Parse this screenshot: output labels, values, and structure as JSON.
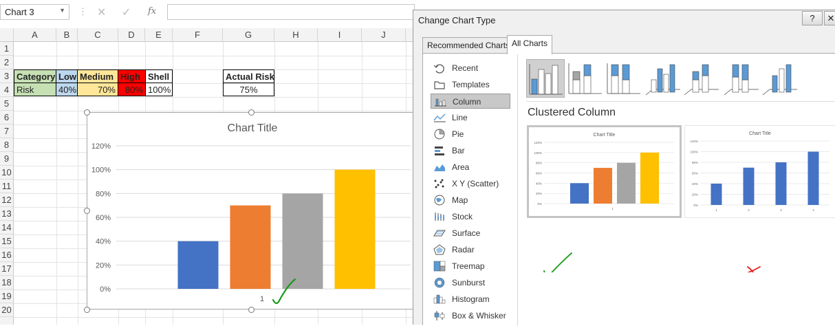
{
  "formula_bar": {
    "name_box": "Chart 3",
    "fx_label": "fx",
    "formula_value": ""
  },
  "grid": {
    "columns": [
      "A",
      "B",
      "C",
      "D",
      "E",
      "F",
      "G",
      "H",
      "I",
      "J"
    ],
    "rows": [
      "1",
      "2",
      "3",
      "4",
      "5",
      "6",
      "7",
      "8",
      "9",
      "10",
      "11",
      "12",
      "13",
      "14",
      "15",
      "16",
      "17",
      "18",
      "19",
      "20"
    ],
    "table": {
      "header": [
        "Category",
        "Low",
        "Medium",
        "High",
        "Shell"
      ],
      "row": [
        "Risk",
        "40%",
        "70%",
        "80%",
        "100%"
      ]
    },
    "actual_risk": {
      "label": "Actual Risk",
      "value": "75%"
    },
    "colors": {
      "category_bg": "#c6e0b4",
      "low_bg": "#bdd7ee",
      "medium_bg": "#ffe699",
      "high_bg": "#ff0000",
      "shell_bg": "#ffffff"
    }
  },
  "chart_data": {
    "type": "bar",
    "title": "Chart Title",
    "categories": [
      "1"
    ],
    "series": [
      {
        "values": [
          0.4
        ],
        "color": "#4472c4"
      },
      {
        "values": [
          0.7
        ],
        "color": "#ed7d31"
      },
      {
        "values": [
          0.8
        ],
        "color": "#a5a5a5"
      },
      {
        "values": [
          1.0
        ],
        "color": "#ffc000"
      }
    ],
    "y_ticks": [
      "0%",
      "20%",
      "40%",
      "60%",
      "80%",
      "100%",
      "120%"
    ],
    "ylim": [
      0,
      1.2
    ],
    "grid": true,
    "annotation": "green checkmark"
  },
  "dialog": {
    "title": "Change Chart Type",
    "help_button": "?",
    "close_button": "✕",
    "tabs": [
      {
        "label": "Recommended Charts",
        "active": false
      },
      {
        "label": "All Charts",
        "active": true
      }
    ],
    "chart_types": [
      {
        "label": "Recent",
        "icon": "recent-icon"
      },
      {
        "label": "Templates",
        "icon": "templates-icon"
      },
      {
        "label": "Column",
        "icon": "column-icon",
        "selected": true
      },
      {
        "label": "Line",
        "icon": "line-icon"
      },
      {
        "label": "Pie",
        "icon": "pie-icon"
      },
      {
        "label": "Bar",
        "icon": "bar-icon"
      },
      {
        "label": "Area",
        "icon": "area-icon"
      },
      {
        "label": "X Y (Scatter)",
        "icon": "scatter-icon"
      },
      {
        "label": "Map",
        "icon": "map-icon"
      },
      {
        "label": "Stock",
        "icon": "stock-icon"
      },
      {
        "label": "Surface",
        "icon": "surface-icon"
      },
      {
        "label": "Radar",
        "icon": "radar-icon"
      },
      {
        "label": "Treemap",
        "icon": "treemap-icon"
      },
      {
        "label": "Sunburst",
        "icon": "sunburst-icon"
      },
      {
        "label": "Histogram",
        "icon": "histogram-icon"
      },
      {
        "label": "Box & Whisker",
        "icon": "box-whisker-icon"
      }
    ],
    "selected_subtype": "Clustered Column",
    "previews": [
      {
        "title": "Chart Title",
        "y_ticks": [
          "0%",
          "20%",
          "40%",
          "60%",
          "80%",
          "100%",
          "120%"
        ],
        "x_labels": [
          "1"
        ],
        "values": [
          0.4,
          0.7,
          0.8,
          1.0
        ],
        "colors": [
          "#4472c4",
          "#ed7d31",
          "#a5a5a5",
          "#ffc000"
        ],
        "mark": "green checkmark",
        "mark_color": "#2ca02c"
      },
      {
        "title": "Chart Title",
        "y_ticks": [
          "0%",
          "20%",
          "40%",
          "60%",
          "80%",
          "100%",
          "120%"
        ],
        "x_labels": [
          "1",
          "2",
          "3",
          "4"
        ],
        "values": [
          0.4,
          0.7,
          0.8,
          1.0
        ],
        "colors": [
          "#4472c4",
          "#4472c4",
          "#4472c4",
          "#4472c4"
        ],
        "mark": "red cross",
        "mark_color": "#e02020"
      }
    ]
  }
}
